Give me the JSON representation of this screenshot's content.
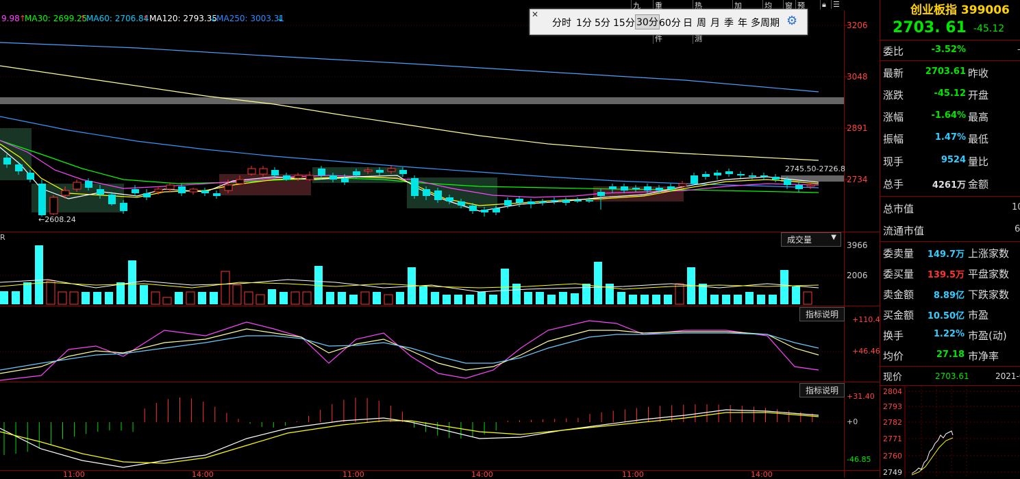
{
  "toolbar": {
    "tabs": [
      "九转",
      "重大事件",
      "热点回测",
      "加自选",
      "均线",
      "窗",
      "预测"
    ]
  },
  "ma_legend": {
    "ma_prefix": "9.98",
    "ma30": "MA30: 2699.25",
    "ma60": "MA60: 2706.84",
    "ma120": "MA120: 2793.35",
    "ma250": "MA250: 3003.31",
    "colors": {
      "ma10": "#ff44ff",
      "ma30": "#00ff00",
      "ma60": "#00ccff",
      "ma120": "#ffffff",
      "ma250": "#3399ff"
    }
  },
  "period_bar": {
    "close": "✕",
    "items": [
      "分时",
      "1分",
      "5分",
      "15分",
      "30分",
      "60分",
      "日",
      "周",
      "月",
      "季",
      "年",
      "多周期"
    ],
    "selected": "30分",
    "settings_icon": "gear-icon"
  },
  "price_axis": {
    "labels": [
      "3206",
      "3048",
      "2891",
      "2734"
    ]
  },
  "volume_axis": {
    "labels": [
      "3966",
      "2006"
    ]
  },
  "kdj_axis": {
    "labels": [
      "+110.4",
      "+46.46"
    ]
  },
  "macd_axis": {
    "labels": [
      "+31.40",
      "+0",
      "-46.85"
    ]
  },
  "time_axis": {
    "labels": [
      "11:00",
      "14:00",
      "11:00",
      "14:00",
      "11:00",
      "14:00"
    ]
  },
  "annotations": {
    "low": "2608.24",
    "high_range": "2745.50-2726.8"
  },
  "volume_panel": {
    "dropdown": "成交量",
    "left_label": "R"
  },
  "indicator_buttons": {
    "kdj": "指标说明",
    "macd": "指标说明"
  },
  "info_panel": {
    "title": "创业板指 399006",
    "price": "2703. 61",
    "change": "-45.12",
    "rows": [
      {
        "k": "委比",
        "v": "-3.52%",
        "color": "#00e600",
        "k2": ""
      },
      {
        "k": "最新",
        "v": "2703.61",
        "color": "#00e600",
        "k2": "昨收"
      },
      {
        "k": "涨跌",
        "v": "-45.12",
        "color": "#00e600",
        "k2": "开盘"
      },
      {
        "k": "涨幅",
        "v": "-1.64%",
        "color": "#00e600",
        "k2": "最高"
      },
      {
        "k": "振幅",
        "v": "1.47%",
        "color": "#33ccff",
        "k2": "最低"
      },
      {
        "k": "现手",
        "v": "9524",
        "color": "#33ccff",
        "k2": "量比"
      },
      {
        "k": "总手",
        "v": "4261万",
        "color": "#dddddd",
        "k2": "金额"
      }
    ],
    "rows2": [
      {
        "k": "总市值",
        "v": "",
        "tail": "10"
      },
      {
        "k": "流通市值",
        "v": "",
        "tail": "6"
      }
    ],
    "rows3": [
      {
        "k": "委卖量",
        "v": "149.7万",
        "color": "#33ccff",
        "k2": "上涨家数"
      },
      {
        "k": "委买量",
        "v": "139.5万",
        "color": "#ff3333",
        "k2": "平盘家数"
      },
      {
        "k": "卖金额",
        "v": "8.89亿",
        "color": "#33ccff",
        "k2": "下跌家数"
      },
      {
        "k": "买金额",
        "v": "10.50亿",
        "color": "#33ccff",
        "k2": "市盈"
      },
      {
        "k": "换手",
        "v": "1.22%",
        "color": "#33ccff",
        "k2": "市盈(动)"
      },
      {
        "k": "均价",
        "v": "27.18",
        "color": "#00e600",
        "k2": "市净率"
      }
    ],
    "mini_header": {
      "k": "现价",
      "v": "2703.61",
      "date": "2021-0"
    },
    "mini_axis": [
      "2804",
      "2793",
      "2782",
      "2771",
      "2760",
      "2749"
    ]
  },
  "chart_data": {
    "type": "candlestick",
    "interval": "30分",
    "y_axis_labels": [
      3206,
      3048,
      2891,
      2734
    ],
    "low_marker": 2608.24,
    "notes": "30-minute candlestick chart of ChiNext index with MA lines, volume, KDJ and MACD sub-panels"
  }
}
